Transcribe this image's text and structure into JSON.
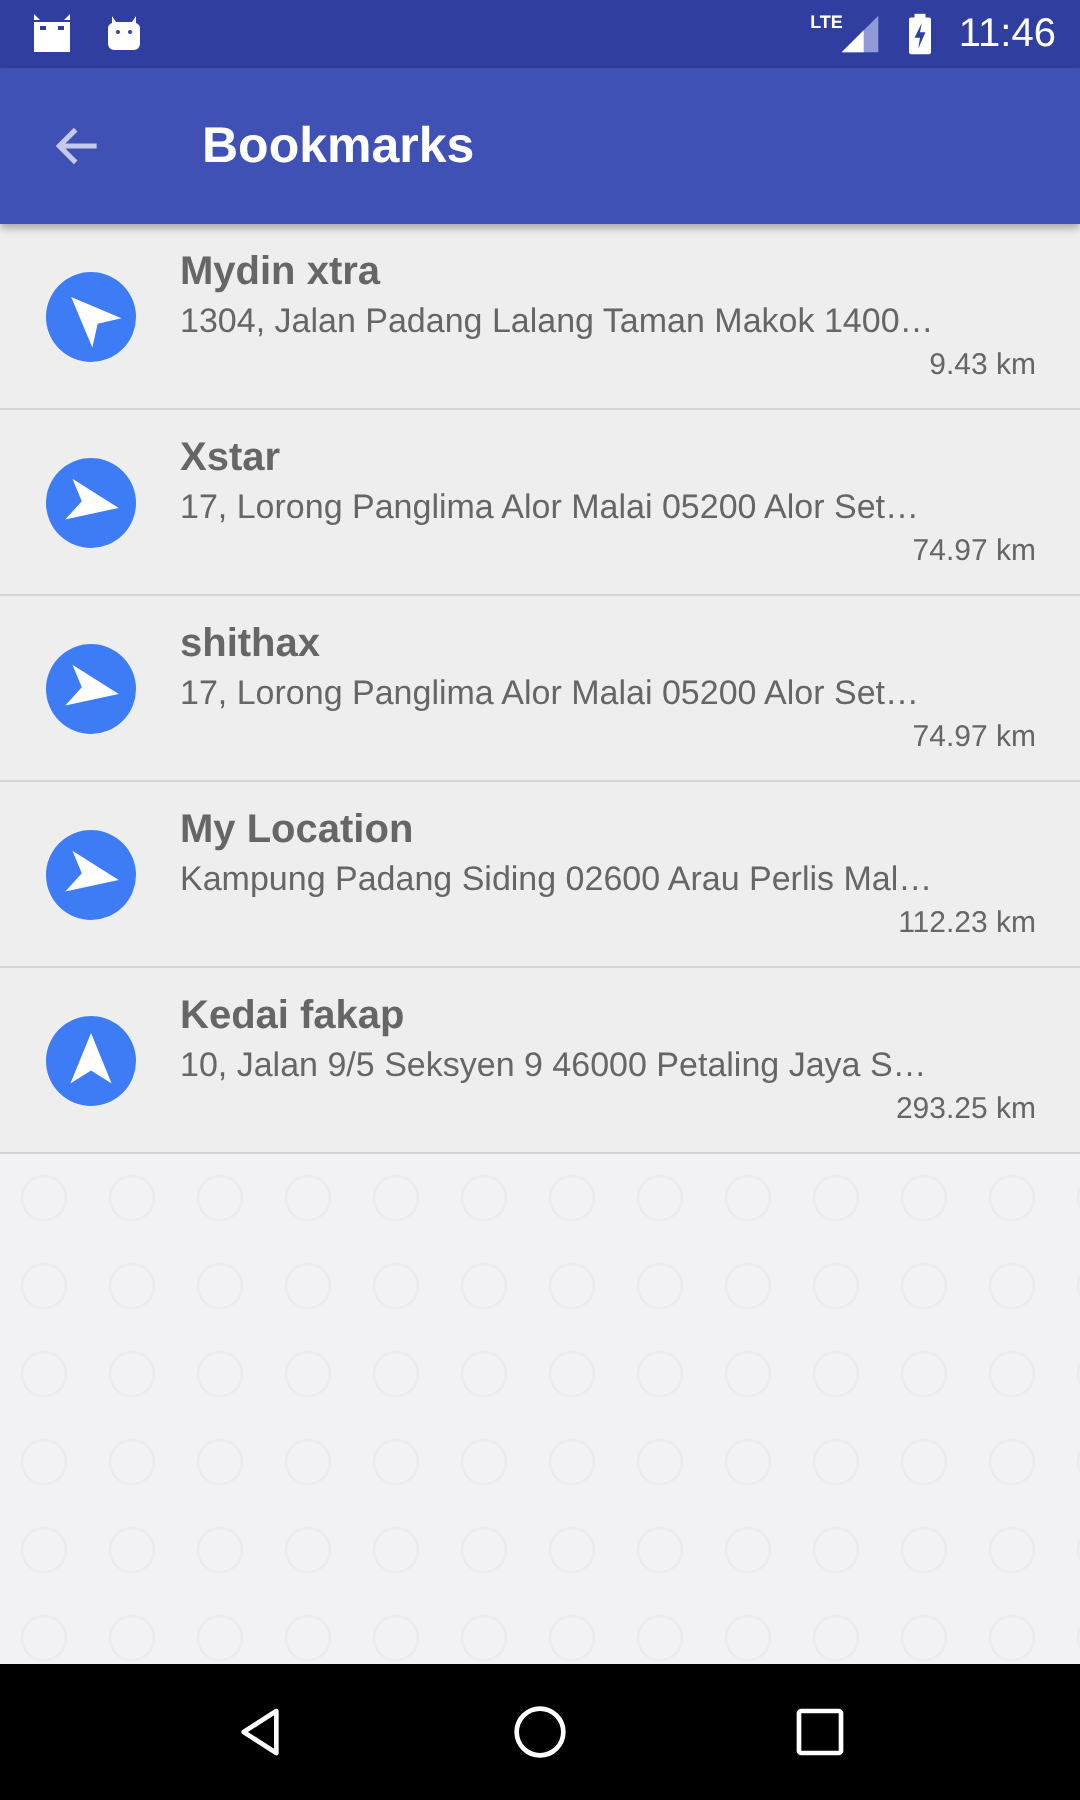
{
  "status_bar": {
    "network": "LTE",
    "time": "11:46"
  },
  "app_bar": {
    "title": "Bookmarks"
  },
  "bookmarks": [
    {
      "name": "Mydin xtra",
      "address": "1304, Jalan Padang Lalang Taman Makok 1400…",
      "distance": "9.43 km"
    },
    {
      "name": "Xstar",
      "address": "17, Lorong Panglima Alor Malai 05200 Alor Set…",
      "distance": "74.97 km"
    },
    {
      "name": "shithax",
      "address": "17, Lorong Panglima Alor Malai 05200 Alor Set…",
      "distance": "74.97 km"
    },
    {
      "name": "My Location",
      "address": "Kampung Padang Siding 02600 Arau Perlis Mal…",
      "distance": "112.23 km"
    },
    {
      "name": "Kedai fakap",
      "address": "10, Jalan 9/5 Seksyen 9 46000 Petaling Jaya S…",
      "distance": "293.25 km"
    }
  ]
}
